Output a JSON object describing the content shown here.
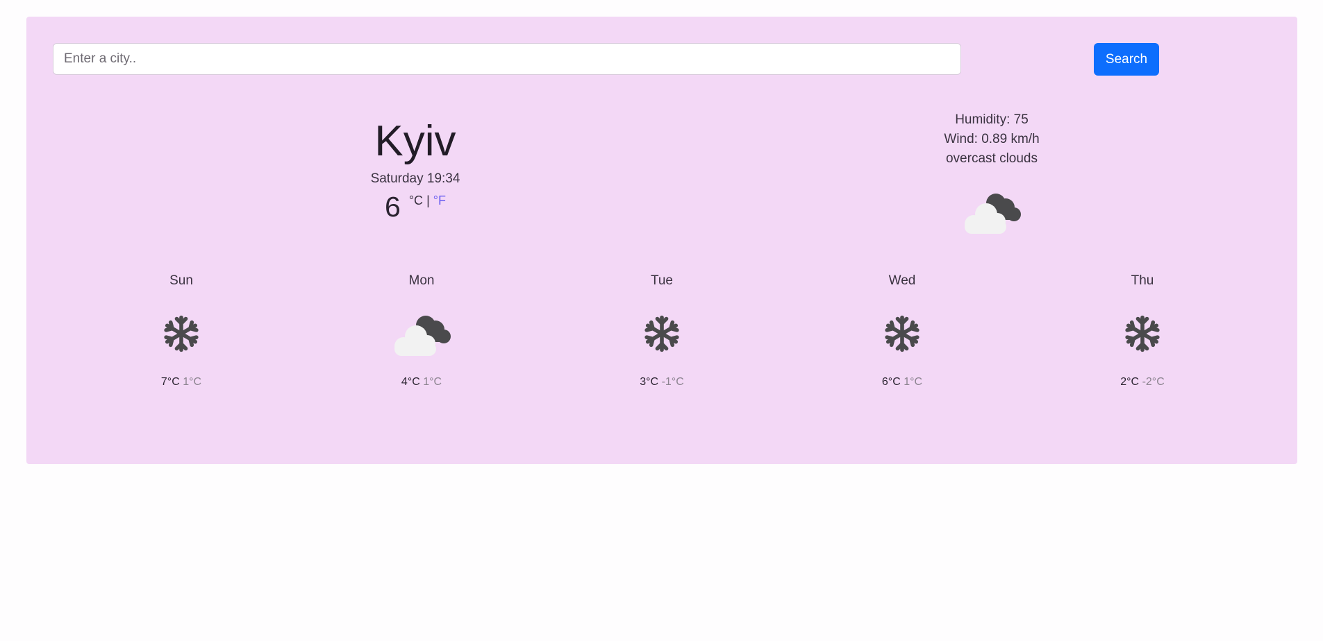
{
  "search": {
    "placeholder": "Enter a city..",
    "button_label": "Search"
  },
  "current": {
    "city": "Kyiv",
    "datetime": "Saturday 19:34",
    "temperature": "6",
    "unit_c": "°C",
    "separator": "|",
    "unit_f": "°F",
    "humidity": "Humidity: 75",
    "wind": "Wind: 0.89 km/h",
    "description": "overcast clouds",
    "icon": "overcast-clouds-icon"
  },
  "forecast": [
    {
      "day": "Sun",
      "icon": "snowflake-icon",
      "max": "7°C",
      "min": "1°C"
    },
    {
      "day": "Mon",
      "icon": "overcast-clouds-icon",
      "max": "4°C",
      "min": "1°C"
    },
    {
      "day": "Tue",
      "icon": "snowflake-icon",
      "max": "3°C",
      "min": "-1°C"
    },
    {
      "day": "Wed",
      "icon": "snowflake-icon",
      "max": "6°C",
      "min": "1°C"
    },
    {
      "day": "Thu",
      "icon": "snowflake-icon",
      "max": "2°C",
      "min": "-2°C"
    }
  ],
  "colors": {
    "panel": "#f3d8f6",
    "accent": "#0d6efd",
    "unit_link": "#6a5ef0"
  }
}
